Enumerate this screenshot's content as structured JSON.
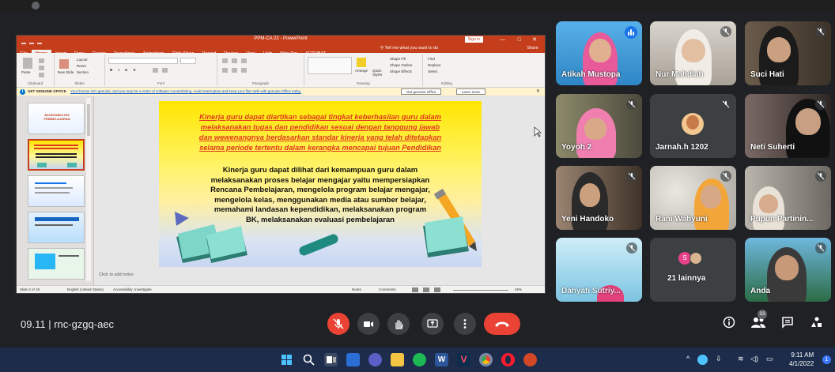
{
  "ppt": {
    "title": "PPM-CA 22 - PowerPoint",
    "signin": "Sign in",
    "tabs": [
      "File",
      "Home",
      "Insert",
      "Draw",
      "Design",
      "Transitions",
      "Animations",
      "Slide Show",
      "Record",
      "Review",
      "View",
      "Help",
      "Nitro Pro",
      "ACROBAT"
    ],
    "tell_me": "Tell me what you want to do",
    "share": "Share",
    "ribbon": {
      "paste": "Paste",
      "new_slide": "New Slide",
      "layout": "Layout",
      "reset": "Reset",
      "section": "Section",
      "clipboard": "Clipboard",
      "slides": "Slides",
      "font": "Font",
      "paragraph": "Paragraph",
      "drawing": "Drawing",
      "arrange": "Arrange",
      "quick_styles": "Quick Styles",
      "shape_fill": "Shape Fill",
      "shape_outline": "Shape Outline",
      "shape_effects": "Shape Effects",
      "find": "Find",
      "replace": "Replace",
      "select": "Select",
      "editing": "Editing"
    },
    "warning": {
      "title": "GET GENUINE OFFICE",
      "message": "Your license isn't genuine, and you may be a victim of software counterfeiting. Avoid interruption and keep your files safe with genuine Office today.",
      "btn_genuine": "Get genuine Office",
      "btn_learn": "Learn more"
    },
    "thumbnails": [
      {
        "num": "1",
        "caption": "AKUNTABILITAS PEMBELAJARAN"
      },
      {
        "num": "2",
        "caption": ""
      },
      {
        "num": "3",
        "caption": ""
      },
      {
        "num": "4",
        "caption": ""
      },
      {
        "num": "5",
        "caption": ""
      }
    ],
    "slide": {
      "red_lines": [
        "Kinerja guru dapat diartikan sebagai tingkat keberhasilan guru dalam",
        "melaksanakan tugas dan pendidikan sesuai dengan tanggung jawab",
        "dan wewenangnya berdasarkan standar kinerja yang telah ditetapkan",
        "selama periode tertentu dalam kerangka mencapai tujuan Pendidikan"
      ],
      "black_lines": [
        "Kinerja guru dapat dilihat dari kemampuan guru dalam",
        "melaksanakan proses belajar mengajar yaitu mempersiapkan",
        "Rencana Pembelajaran, mengelola program belajar mengajar,",
        "mengelola kelas, menggunakan media atau sumber belajar,",
        "memahami landasan kependidikan, melaksanakan program",
        "BK, melaksanakan evaluasi pembelajaran"
      ]
    },
    "notes_placeholder": "Click to add notes",
    "status": {
      "slide_count": "Slide 2 of 19",
      "language": "English (United States)",
      "accessibility": "Accessibility: Investigate",
      "notes": "Notes",
      "comments": "Comments",
      "zoom": "45%"
    }
  },
  "participants": [
    {
      "name": "Atikah Mustopa",
      "speaking": true
    },
    {
      "name": "Nur Mahdiah",
      "speaking": false
    },
    {
      "name": "Suci Hati",
      "speaking": false
    },
    {
      "name": "Yoyoh 2",
      "speaking": false
    },
    {
      "name": "Jarnah.h 1202",
      "speaking": false
    },
    {
      "name": "Neti Suherti",
      "speaking": false
    },
    {
      "name": "Yeni Handoko",
      "speaking": false
    },
    {
      "name": "Rani Wahyuni",
      "speaking": false
    },
    {
      "name": "Pupun Partinin...",
      "speaking": false
    },
    {
      "name": "Dahyati Sutriy...",
      "speaking": false
    },
    {
      "name": "21 lainnya",
      "speaking": false
    },
    {
      "name": "Anda",
      "speaking": false
    }
  ],
  "others_avatar_letter": "S",
  "meet": {
    "time": "09.11",
    "meeting_code": "rnc-gzgq-aec",
    "participant_count": "33"
  },
  "taskbar": {
    "time": "9:11 AM",
    "date": "4/1/2022"
  }
}
